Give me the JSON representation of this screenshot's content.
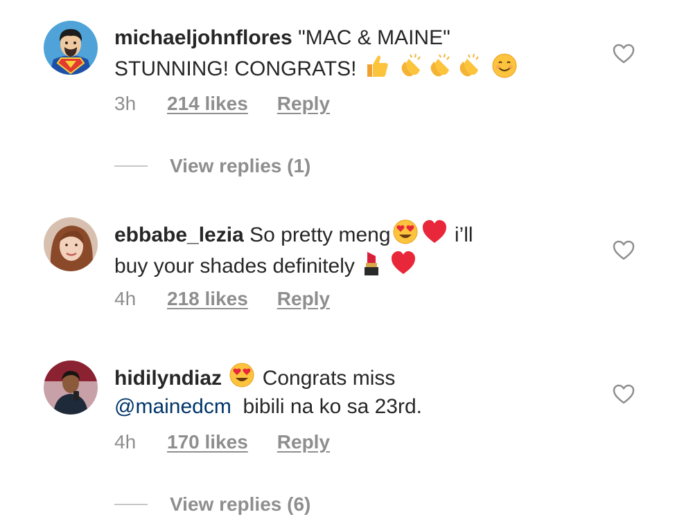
{
  "comments": [
    {
      "username": "michaeljohnflores",
      "text_1": " \"MAC & MAINE\"",
      "text_2": "STUNNING! CONGRATS! ",
      "emojis": [
        "thumbs-up",
        "clapping-hands",
        "clapping-hands",
        "clapping-hands",
        "smiling-face"
      ],
      "time": "3h",
      "likes": "214 likes",
      "reply": "Reply"
    },
    {
      "username": "ebbabe_lezia",
      "text_1": " So pretty meng",
      "text_1b": " i’ll",
      "text_2": "buy your shades definitely",
      "emojis": [
        "heart-eyes",
        "red-heart",
        "lipstick",
        "red-heart"
      ],
      "time": "4h",
      "likes": "218 likes",
      "reply": "Reply"
    },
    {
      "username": "hidilyndiaz",
      "text_1": " Congrats miss",
      "mention": "@mainedcm",
      "text_2": "  bibili na ko sa 23rd.",
      "emojis": [
        "heart-eyes"
      ],
      "time": "4h",
      "likes": "170 likes",
      "reply": "Reply"
    }
  ],
  "view_replies": [
    {
      "label": "View replies (1)"
    },
    {
      "label": "View replies (6)"
    }
  ],
  "colors": {
    "text": "#262626",
    "secondary": "#8e8e8e",
    "mention": "#003569",
    "divider": "#c7c7c7"
  }
}
